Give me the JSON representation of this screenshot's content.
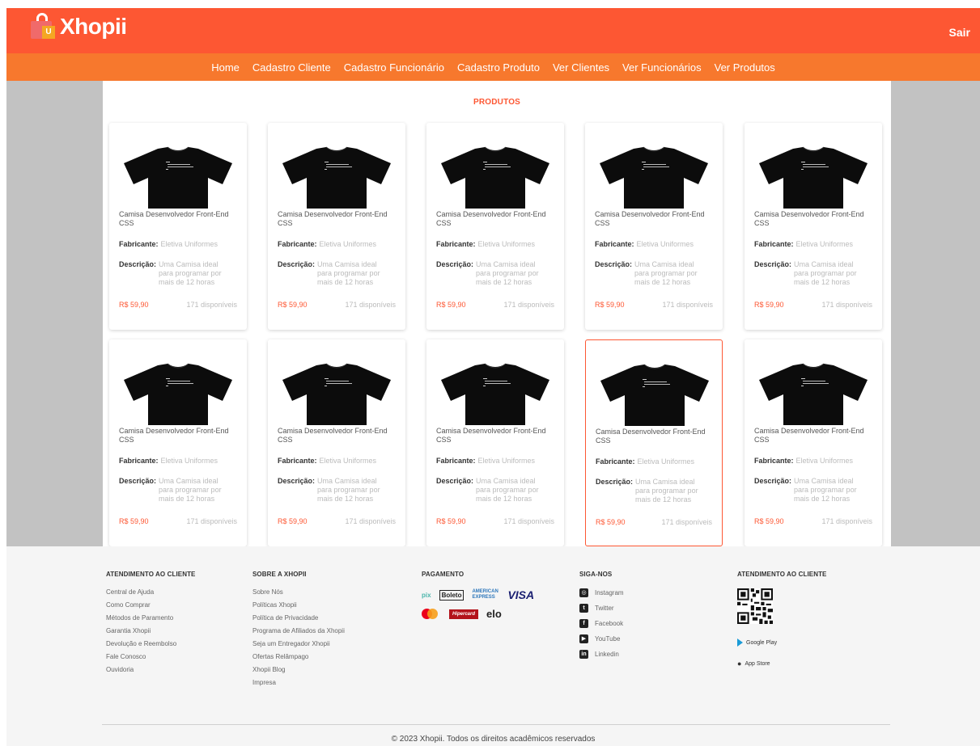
{
  "brand": {
    "name": "Xhopii",
    "logo_mark": "U",
    "primary_color": "#fd5733",
    "nav_color": "#f7782d"
  },
  "header": {
    "logout_label": "Sair"
  },
  "nav": {
    "items": [
      "Home",
      "Cadastro Cliente",
      "Cadastro Funcionário",
      "Cadastro Produto",
      "Ver Clientes",
      "Ver Funcionários",
      "Ver Produtos"
    ]
  },
  "main": {
    "title": "PRODUTOS"
  },
  "products": [
    {
      "title": "Camisa Desenvolvedor Front-End CSS",
      "maker_label": "Fabricante:",
      "maker": "Eletiva Uniformes",
      "desc_label": "Descrição:",
      "desc": "Uma Camisa ideal para programar por mais de 12 horas",
      "price": "R$ 59,90",
      "stock": "171 disponíveis"
    },
    {
      "title": "Camisa Desenvolvedor Front-End CSS",
      "maker_label": "Fabricante:",
      "maker": "Eletiva Uniformes",
      "desc_label": "Descrição:",
      "desc": "Uma Camisa ideal para programar por mais de 12 horas",
      "price": "R$ 59,90",
      "stock": "171 disponíveis"
    },
    {
      "title": "Camisa Desenvolvedor Front-End CSS",
      "maker_label": "Fabricante:",
      "maker": "Eletiva Uniformes",
      "desc_label": "Descrição:",
      "desc": "Uma Camisa ideal para programar por mais de 12 horas",
      "price": "R$ 59,90",
      "stock": "171 disponíveis"
    },
    {
      "title": "Camisa Desenvolvedor Front-End CSS",
      "maker_label": "Fabricante:",
      "maker": "Eletiva Uniformes",
      "desc_label": "Descrição:",
      "desc": "Uma Camisa ideal para programar por mais de 12 horas",
      "price": "R$ 59,90",
      "stock": "171 disponíveis"
    },
    {
      "title": "Camisa Desenvolvedor Front-End CSS",
      "maker_label": "Fabricante:",
      "maker": "Eletiva Uniformes",
      "desc_label": "Descrição:",
      "desc": "Uma Camisa ideal para programar por mais de 12 horas",
      "price": "R$ 59,90",
      "stock": "171 disponíveis"
    },
    {
      "title": "Camisa Desenvolvedor Front-End CSS",
      "maker_label": "Fabricante:",
      "maker": "Eletiva Uniformes",
      "desc_label": "Descrição:",
      "desc": "Uma Camisa ideal para programar por mais de 12 horas",
      "price": "R$ 59,90",
      "stock": "171 disponíveis"
    },
    {
      "title": "Camisa Desenvolvedor Front-End CSS",
      "maker_label": "Fabricante:",
      "maker": "Eletiva Uniformes",
      "desc_label": "Descrição:",
      "desc": "Uma Camisa ideal para programar por mais de 12 horas",
      "price": "R$ 59,90",
      "stock": "171 disponíveis"
    },
    {
      "title": "Camisa Desenvolvedor Front-End CSS",
      "maker_label": "Fabricante:",
      "maker": "Eletiva Uniformes",
      "desc_label": "Descrição:",
      "desc": "Uma Camisa ideal para programar por mais de 12 horas",
      "price": "R$ 59,90",
      "stock": "171 disponíveis"
    },
    {
      "title": "Camisa Desenvolvedor Front-End CSS",
      "maker_label": "Fabricante:",
      "maker": "Eletiva Uniformes",
      "desc_label": "Descrição:",
      "desc": "Uma Camisa ideal para programar por mais de 12 horas",
      "price": "R$ 59,90",
      "stock": "171 disponíveis",
      "highlighted": true
    },
    {
      "title": "Camisa Desenvolvedor Front-End CSS",
      "maker_label": "Fabricante:",
      "maker": "Eletiva Uniformes",
      "desc_label": "Descrição:",
      "desc": "Uma Camisa ideal para programar por mais de 12 horas",
      "price": "R$ 59,90",
      "stock": "171 disponíveis"
    }
  ],
  "footer": {
    "customer_service": {
      "title": "ATENDIMENTO AO CLIENTE",
      "links": [
        "Central de Ajuda",
        "Como Comprar",
        "Métodos de Paramento",
        "Garantia Xhopii",
        "Devolução e Reembolso",
        "Fale Conosco",
        "Ouvidoria"
      ]
    },
    "about": {
      "title": "SOBRE A XHOPII",
      "links": [
        "Sobre Nós",
        "Políticas Xhopii",
        "Política de Privacidade",
        "Programa de Afiliados da Xhopii",
        "Seja um Entregador Xhopii",
        "Ofertas Relâmpago",
        "Xhopii Blog",
        "Impresa"
      ]
    },
    "payment": {
      "title": "PAGAMENTO",
      "methods": [
        "pix",
        "Boleto",
        "AMERICAN EXPRESS",
        "VISA",
        "mastercard",
        "Hipercard",
        "elo"
      ]
    },
    "follow": {
      "title": "SIGA-NOS",
      "links": [
        {
          "label": "Instagram",
          "icon": "instagram-icon"
        },
        {
          "label": "Twitter",
          "icon": "twitter-icon"
        },
        {
          "label": "Facebook",
          "icon": "facebook-icon"
        },
        {
          "label": "YouTube",
          "icon": "youtube-icon"
        },
        {
          "label": "Linkedin",
          "icon": "linkedin-icon"
        }
      ]
    },
    "apps": {
      "title": "ATENDIMENTO AO CLIENTE",
      "google_play": "Google Play",
      "app_store": "App Store"
    },
    "copyright": "© 2023 Xhopii. Todos os direitos acadêmicos reservados"
  }
}
